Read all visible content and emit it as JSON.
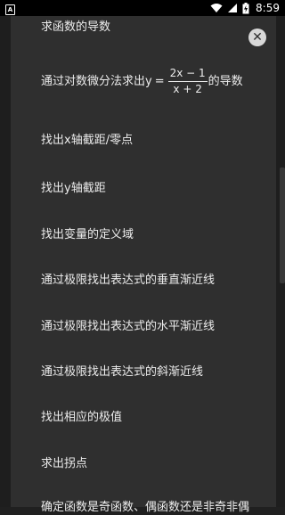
{
  "status_bar": {
    "notification_icon": "A",
    "icons": [
      "wifi-icon",
      "signal-icon",
      "battery-charging-icon"
    ],
    "time": "8:59"
  },
  "colors": {
    "panel_bg": "#2f2f2f",
    "text": "#ececec",
    "close_button": "#d8d8d8"
  },
  "panel": {
    "close_icon": "✕",
    "items": [
      {
        "label": "求函数的导数"
      },
      {
        "label_prefix": "通过对数微分法求出y",
        "equals": "=",
        "numerator": "2x − 1",
        "denominator": "x + 2",
        "label_suffix": "的导数"
      },
      {
        "label": "找出x轴截距/零点"
      },
      {
        "label": "找出y轴截距"
      },
      {
        "label": "找出变量的定义域"
      },
      {
        "label": "通过极限找出表达式的垂直渐近线"
      },
      {
        "label": "通过极限找出表达式的水平渐近线"
      },
      {
        "label": "通过极限找出表达式的斜渐近线"
      },
      {
        "label": "找出相应的极值"
      },
      {
        "label": "求出拐点"
      },
      {
        "label": "确定函数是奇函数、偶函数还是非奇非偶"
      }
    ]
  }
}
